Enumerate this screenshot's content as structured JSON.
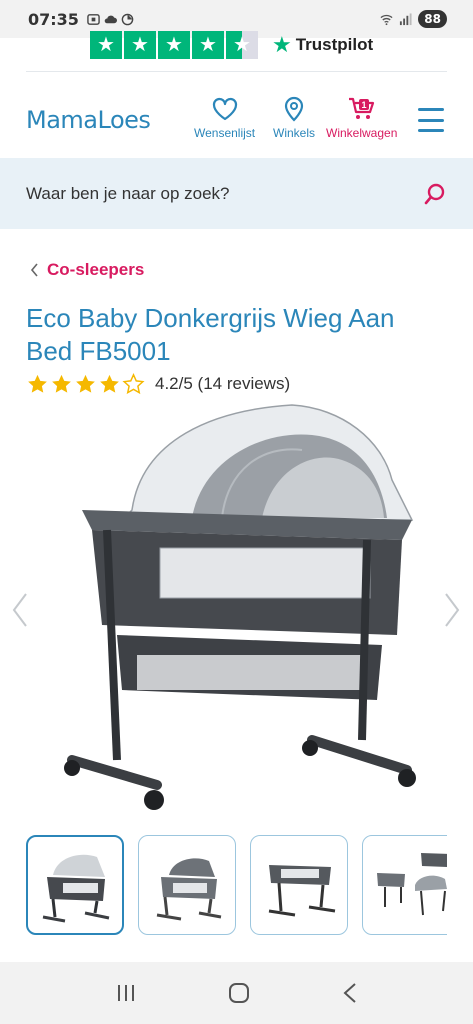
{
  "status_bar": {
    "time": "07:35",
    "battery": "88"
  },
  "trustpilot": {
    "brand": "Trustpilot",
    "star_glyph": "★"
  },
  "header": {
    "logo": "MamaLoes",
    "wishlist_label": "Wensenlijst",
    "stores_label": "Winkels",
    "cart_label": "Winkelwagen",
    "cart_count": "1"
  },
  "search": {
    "placeholder": "Waar ben je naar op zoek?"
  },
  "breadcrumb": {
    "label": "Co-sleepers"
  },
  "product": {
    "title": "Eco Baby Donkergrijs Wieg Aan Bed FB5001",
    "rating": 4.2,
    "rating_text": "4.2/5 (14 reviews)"
  },
  "gallery": {
    "thumbnail_count": 4,
    "active_index": 0
  },
  "colors": {
    "brand_blue": "#2b86b9",
    "accent_pink": "#d81b60",
    "star_gold": "#f5b800",
    "trust_green": "#00b67a",
    "search_bg": "#e8f1f7"
  }
}
